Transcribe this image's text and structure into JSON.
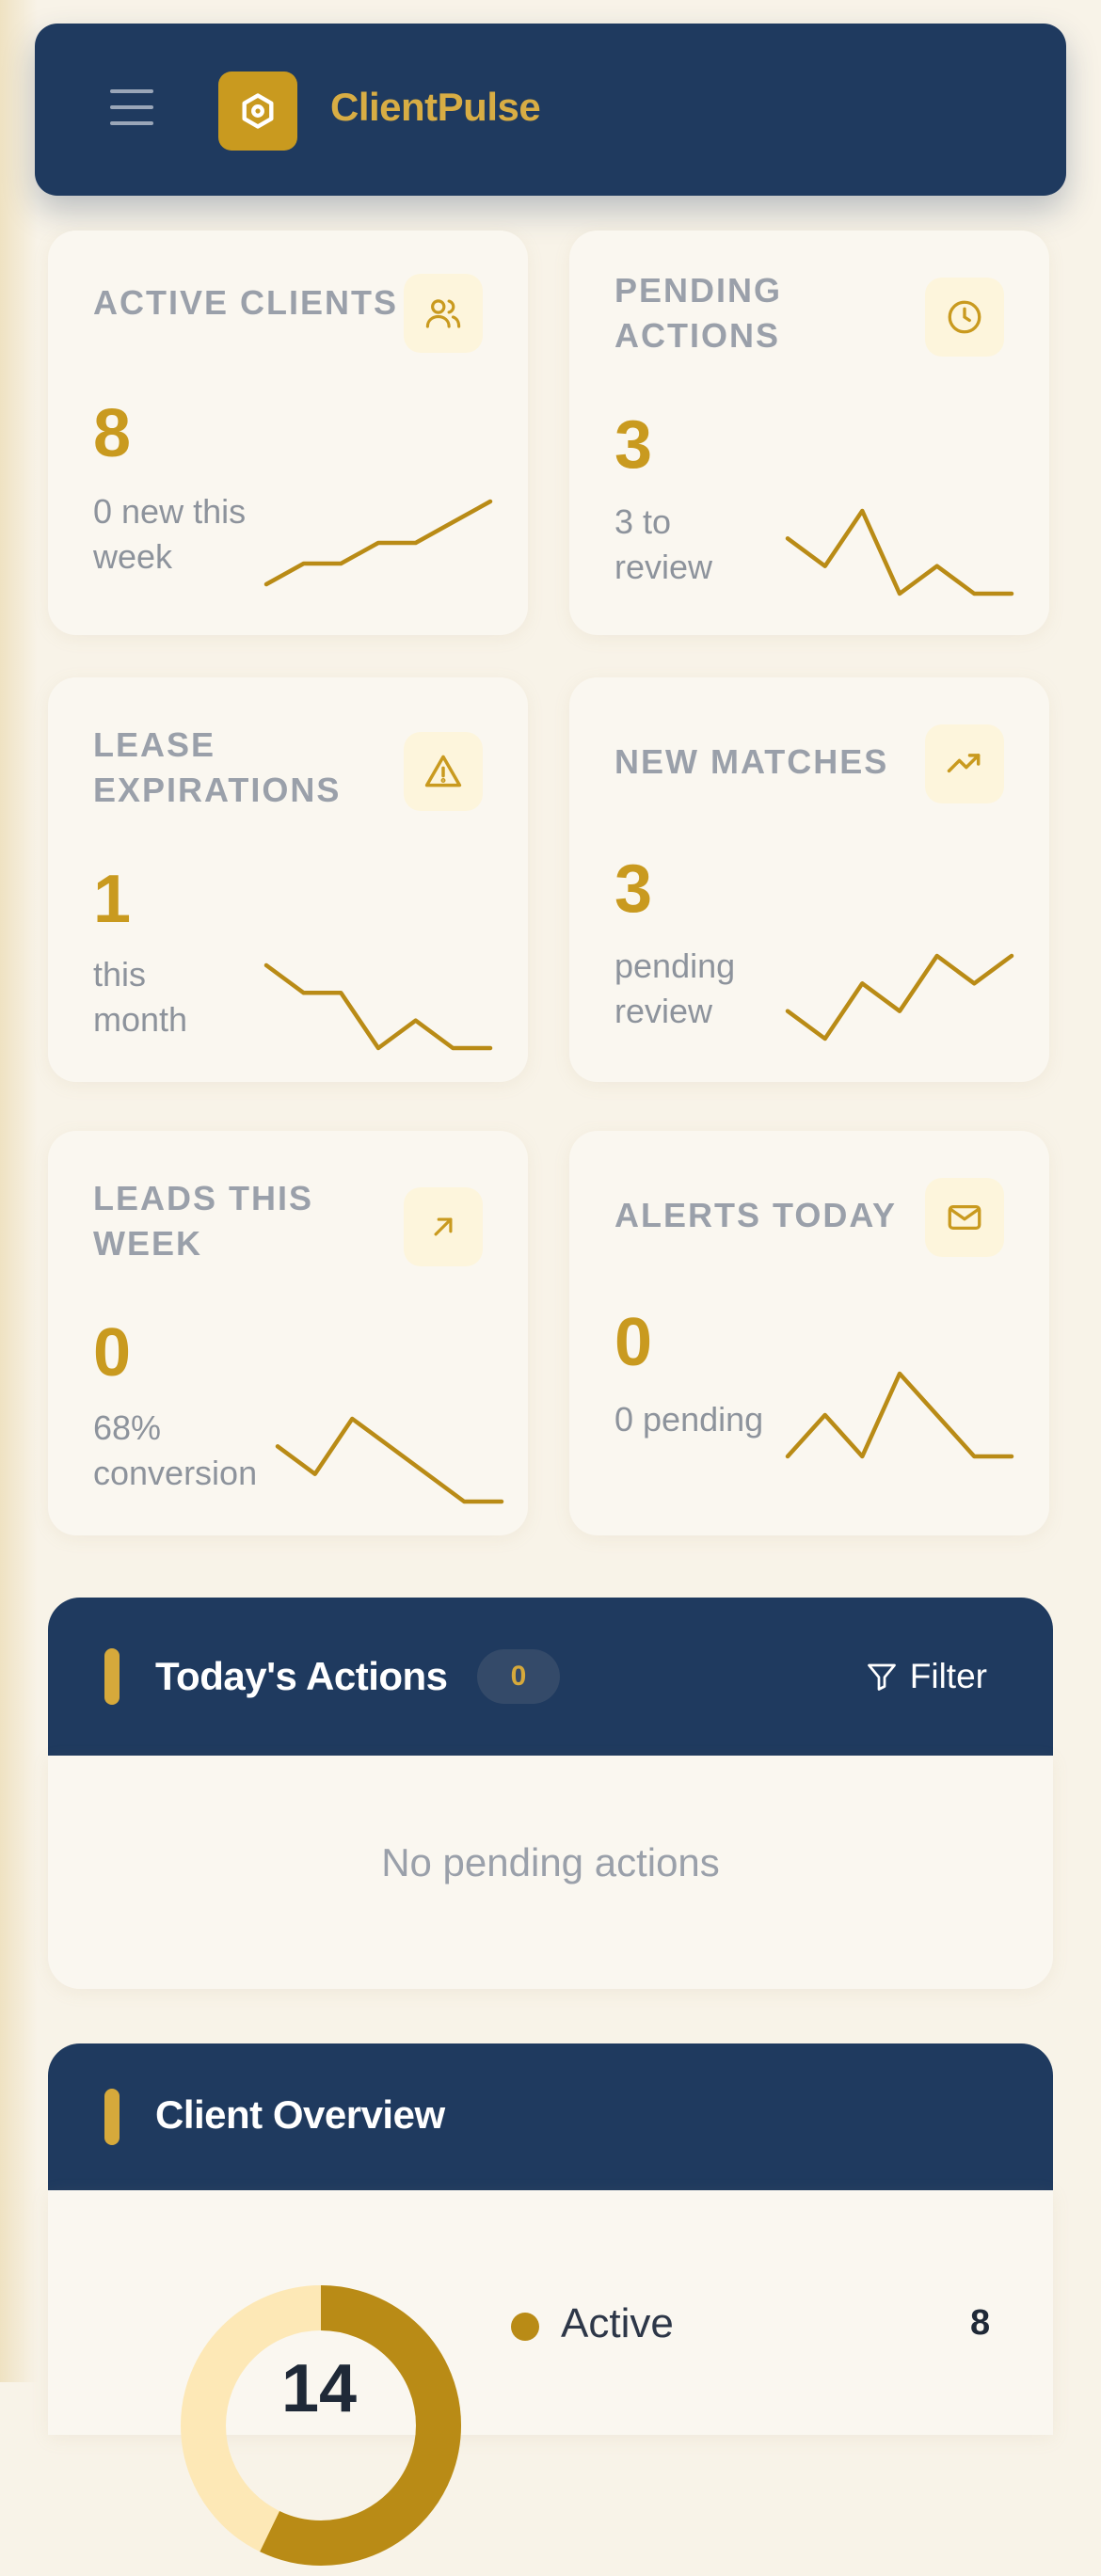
{
  "app": {
    "name": "ClientPulse"
  },
  "colors": {
    "navy": "#1f3a5f",
    "gold": "#c99a1f",
    "background": "#f8f3e8",
    "card": "#faf7f0"
  },
  "stats": [
    {
      "title": "ACTIVE CLIENTS",
      "value": "8",
      "sub": "0 new this week",
      "icon": "users-icon",
      "trend": [
        0,
        1,
        1,
        2,
        2,
        3,
        4
      ]
    },
    {
      "title": "PENDING ACTIONS",
      "value": "3",
      "sub": "3 to review",
      "icon": "clock-icon",
      "trend": [
        2,
        1,
        3,
        0,
        1,
        0,
        0
      ]
    },
    {
      "title": "LEASE EXPIRATIONS",
      "value": "1",
      "sub": "this month",
      "icon": "alert-triangle-icon",
      "trend": [
        3,
        2,
        2,
        0,
        1,
        0,
        0
      ]
    },
    {
      "title": "NEW MATCHES",
      "value": "3",
      "sub": "pending review",
      "icon": "trending-up-icon",
      "trend": [
        1,
        0,
        2,
        1,
        3,
        2,
        3
      ]
    },
    {
      "title": "LEADS THIS WEEK",
      "value": "0",
      "sub": "68% conversion",
      "icon": "arrow-up-right-icon",
      "trend": [
        2,
        1,
        3,
        2,
        1,
        0,
        0
      ]
    },
    {
      "title": "ALERTS TODAY",
      "value": "0",
      "sub": "0 pending",
      "icon": "mail-icon",
      "trend": [
        0,
        1,
        0,
        2,
        1,
        0,
        0
      ]
    }
  ],
  "todays_actions": {
    "title": "Today's Actions",
    "count": "0",
    "filter_label": "Filter",
    "empty_text": "No pending actions"
  },
  "client_overview": {
    "title": "Client Overview",
    "total": "14",
    "legend": [
      {
        "label": "Active",
        "value": "8"
      }
    ],
    "active_fraction": 0.5714
  }
}
